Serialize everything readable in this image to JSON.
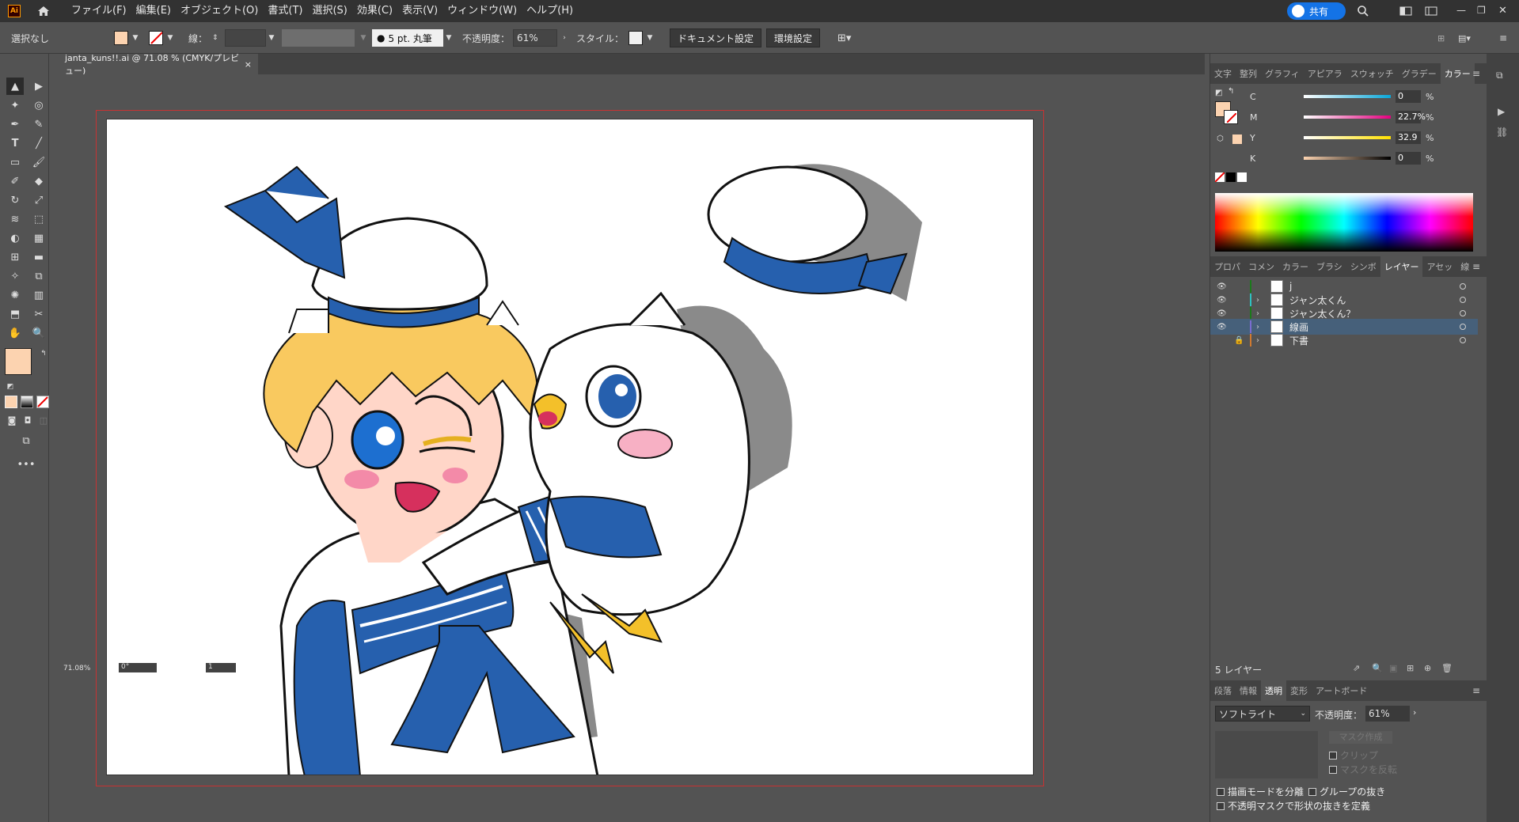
{
  "app": {
    "logo": "Ai"
  },
  "menu": [
    "ファイル(F)",
    "編集(E)",
    "オブジェクト(O)",
    "書式(T)",
    "選択(S)",
    "効果(C)",
    "表示(V)",
    "ウィンドウ(W)",
    "ヘルプ(H)"
  ],
  "share_label": "共有",
  "control": {
    "selection": "選択なし",
    "stroke_label": "線：",
    "brush": "5 pt. 丸筆",
    "opacity_label": "不透明度：",
    "opacity_value": "61%",
    "style_label": "スタイル：",
    "doc_settings": "ドキュメント設定",
    "prefs": "環境設定"
  },
  "document_tab": {
    "title": "janta_kuns!!.ai @ 71.08 % (CMYK/プレビュー)",
    "close": "×"
  },
  "status": {
    "zoom": "71.08%",
    "rotate": "0°",
    "artboard": "1"
  },
  "color_panel": {
    "tabs": [
      "文字",
      "整列",
      "グラフィ",
      "アピアラ",
      "スウォッチ",
      "グラデー",
      "カラー"
    ],
    "active_tab": "カラー",
    "channels": [
      {
        "label": "C",
        "value": "0"
      },
      {
        "label": "M",
        "value": "22.7%"
      },
      {
        "label": "Y",
        "value": "32.9"
      },
      {
        "label": "K",
        "value": "0"
      }
    ],
    "unit": "%"
  },
  "layers_panel": {
    "tabs": [
      "プロパ",
      "コメン",
      "カラー",
      "ブラシ",
      "シンボ",
      "レイヤー",
      "アセッ",
      "線"
    ],
    "active_tab": "レイヤー",
    "layers": [
      {
        "name": "j",
        "color": "#1b7a1b",
        "visible": true,
        "locked": false,
        "expand": false,
        "selected": false
      },
      {
        "name": "ジャン太くん",
        "color": "#2ec1c1",
        "visible": true,
        "locked": false,
        "expand": true,
        "selected": false
      },
      {
        "name": "ジャン太くん？",
        "color": "#1b7a1b",
        "visible": true,
        "locked": false,
        "expand": true,
        "selected": false
      },
      {
        "name": "線画",
        "color": "#7a6cd0",
        "visible": true,
        "locked": false,
        "expand": true,
        "selected": true
      },
      {
        "name": "下書",
        "color": "#d07a30",
        "visible": false,
        "locked": true,
        "expand": true,
        "selected": false
      }
    ],
    "count": "5 レイヤー"
  },
  "transparency_panel": {
    "tabs": [
      "段落",
      "情報",
      "透明",
      "変形",
      "アートボード"
    ],
    "active_tab": "透明",
    "blend_mode": "ソフトライト",
    "opacity_label": "不透明度：",
    "opacity_value": "61%",
    "make_mask": "マスク作成",
    "clip": "クリップ",
    "invert_mask": "マスクを反転",
    "isolate_blending": "描画モードを分離",
    "knockout_group": "グループの抜き",
    "opacity_mask_define": "不透明マスクで形状の抜きを定義"
  },
  "colors": {
    "fill": "#fcd3b0",
    "accent": "#1473e6",
    "uniform_blue": "#2660ae"
  }
}
